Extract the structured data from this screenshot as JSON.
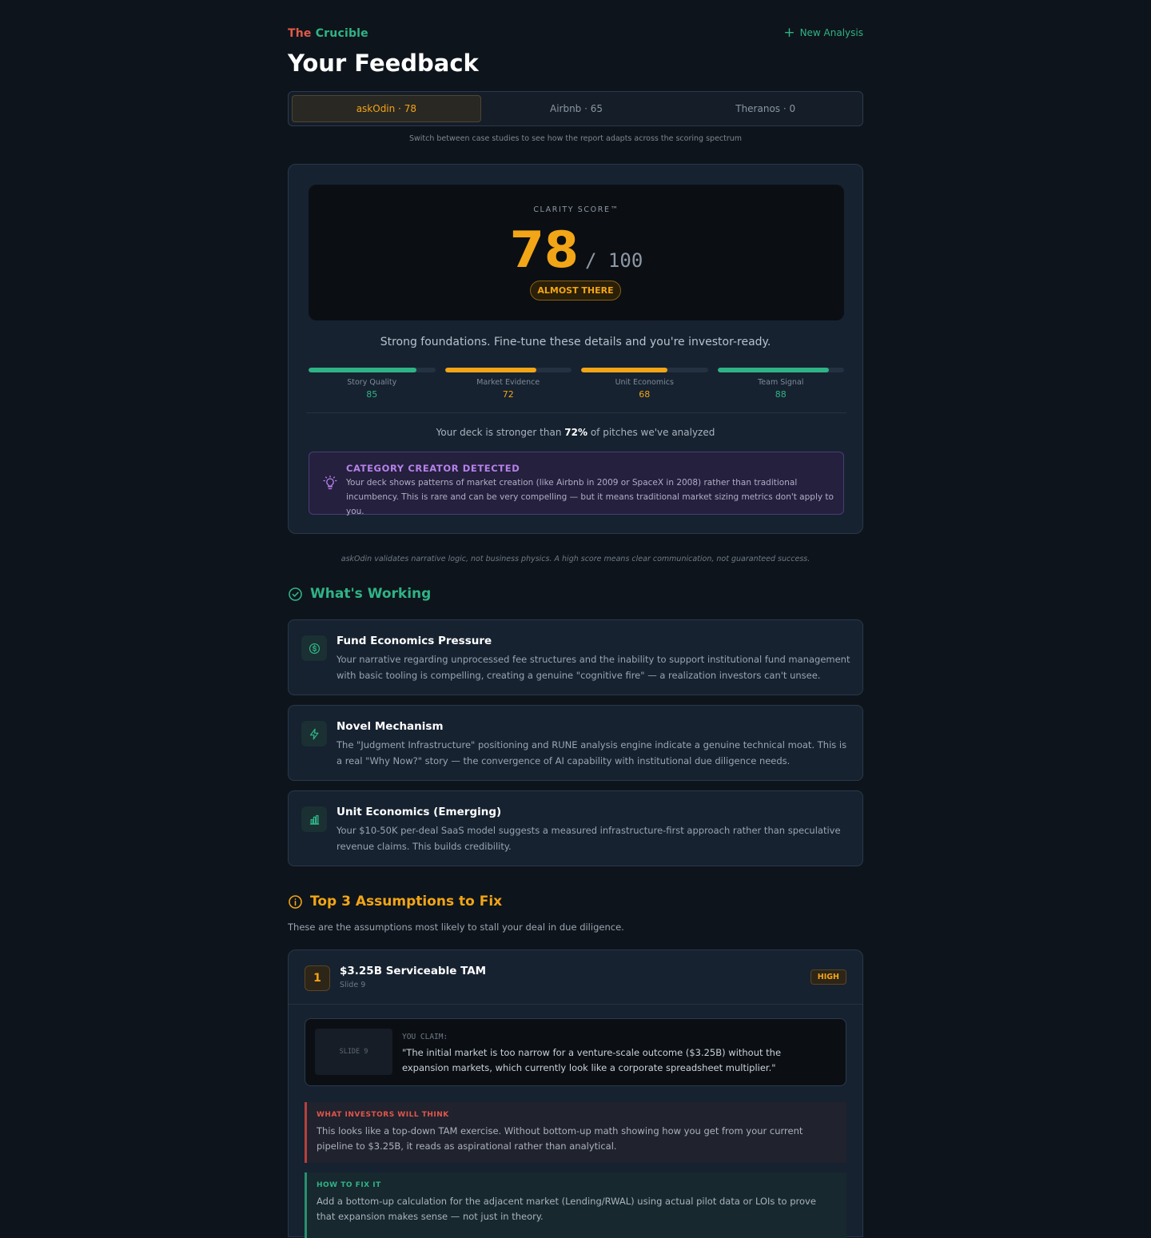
{
  "header": {
    "brand_the": "The",
    "brand_name": "Crucible",
    "title": "Your Feedback",
    "new_analysis": "New Analysis"
  },
  "tabs": [
    {
      "label": "askOdin · 78",
      "active": true
    },
    {
      "label": "Airbnb · 65",
      "active": false
    },
    {
      "label": "Theranos · 0",
      "active": false
    }
  ],
  "tabs_hint": "Switch between case studies to see how the report adapts across the scoring spectrum",
  "score": {
    "label": "CLARITY SCORE™",
    "value": "78",
    "out_of": "/ 100",
    "badge": "ALMOST THERE",
    "tagline": "Strong foundations. Fine-tune these details and you're investor-ready."
  },
  "metrics": [
    {
      "label": "Story Quality",
      "value": "85",
      "fill": 0.85,
      "color": "#2fb386"
    },
    {
      "label": "Market Evidence",
      "value": "72",
      "fill": 0.72,
      "color": "#f2a516"
    },
    {
      "label": "Unit Economics",
      "value": "68",
      "fill": 0.68,
      "color": "#f2a516"
    },
    {
      "label": "Team Signal",
      "value": "88",
      "fill": 0.88,
      "color": "#2fb386"
    }
  ],
  "comparison": {
    "prefix": "Your deck is stronger than",
    "percent": "72%",
    "suffix": "of pitches we've analyzed"
  },
  "category_creator": {
    "title": "CATEGORY CREATOR DETECTED",
    "body": "Your deck shows patterns of market creation (like Airbnb in 2009 or SpaceX in 2008) rather than traditional incumbency. This is rare and can be very compelling — but it means traditional market sizing metrics don't apply to you."
  },
  "disclaimer": "askOdin validates narrative logic, not business physics. A high score means clear communication, not guaranteed success.",
  "working": {
    "title": "What's Working",
    "items": [
      {
        "icon": "dollar-icon",
        "title": "Fund Economics Pressure",
        "body": "Your narrative regarding unprocessed fee structures and the inability to support institutional fund management with basic tooling is compelling, creating a genuine \"cognitive fire\" — a realization investors can't unsee."
      },
      {
        "icon": "lightning-icon",
        "title": "Novel Mechanism",
        "body": "The \"Judgment Infrastructure\" positioning and RUNE analysis engine indicate a genuine technical moat. This is a real \"Why Now?\" story — the convergence of AI capability with institutional due diligence needs."
      },
      {
        "icon": "bar-chart-icon",
        "title": "Unit Economics (Emerging)",
        "body": "Your $10-50K per-deal SaaS model suggests a measured infrastructure-first approach rather than speculative revenue claims. This builds credibility."
      }
    ]
  },
  "fixes": {
    "title": "Top 3 Assumptions to Fix",
    "subtitle": "These are the assumptions most likely to stall your deal in due diligence.",
    "items": [
      {
        "number": "1",
        "title": "$3.25B Serviceable TAM",
        "slide": "Slide 9",
        "severity": "HIGH",
        "thumb": "SLIDE 9",
        "claim_label": "YOU CLAIM:",
        "claim": "\"The initial market is too narrow for a venture-scale outcome ($3.25B) without the expansion markets, which currently look like a corporate spreadsheet multiplier.\"",
        "think_label": "WHAT INVESTORS WILL THINK",
        "think": "This looks like a top-down TAM exercise. Without bottom-up math showing how you get from your current pipeline to $3.25B, it reads as aspirational rather than analytical.",
        "fix_label": "HOW TO FIX IT",
        "fix": "Add a bottom-up calculation for the adjacent market (Lending/RWAL) using actual pilot data or LOIs to prove that expansion makes sense — not just in theory."
      }
    ]
  },
  "colors": {
    "background": "#0e141b",
    "card": "#162230",
    "amber": "#f2a516",
    "green": "#2fb386",
    "red": "#e05a4a",
    "purple": "#b681ea"
  }
}
